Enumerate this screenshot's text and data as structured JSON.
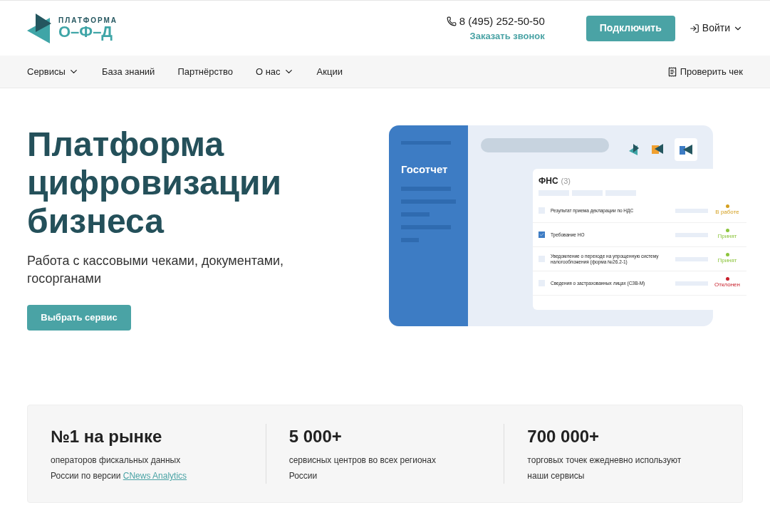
{
  "logo": {
    "line_1": "ПЛАТФОРМА",
    "line_2": "О–Ф–Д"
  },
  "header": {
    "phone": "8 (495) 252-50-50",
    "callback": "Заказать звонок",
    "connect": "Подключить",
    "login": "Войти"
  },
  "nav": {
    "items": [
      {
        "label": "Сервисы",
        "dropdown": true
      },
      {
        "label": "База знаний",
        "dropdown": false
      },
      {
        "label": "Партнёрство",
        "dropdown": false
      },
      {
        "label": "О нас",
        "dropdown": true
      },
      {
        "label": "Акции",
        "dropdown": false
      }
    ],
    "check": "Проверить чек"
  },
  "hero": {
    "title": "Платформа цифровизации бизнеса",
    "subtitle": "Работа с кассовыми чеками, документами, госорганами",
    "button": "Выбрать сервис"
  },
  "illustration": {
    "sidebar_title": "Госотчет",
    "panel_title": "ФНС",
    "panel_count": "(3)",
    "rows": [
      {
        "text": "Результат приема декларации по НДС",
        "checked": false,
        "status": "В работе",
        "color": "#d4a020"
      },
      {
        "text": "Требование НО",
        "checked": true,
        "status": "Принят",
        "color": "#8cc43c"
      },
      {
        "text": "Уведомление о переходе на упрощенную систему налогообложения (форма №26.2-1)",
        "checked": false,
        "status": "Принят",
        "color": "#8cc43c"
      },
      {
        "text": "Сведения о застрахованных лицах (СЗВ-М)",
        "checked": false,
        "status": "Отклонен",
        "color": "#c8202c"
      }
    ]
  },
  "stats": [
    {
      "value": "№1 на рынке",
      "text": "операторов фискальных данных России по версии",
      "link": "CNews Analytics"
    },
    {
      "value": "5 000+",
      "text": "сервисных центров во всех регионах России"
    },
    {
      "value": "700 000+",
      "text": "торговых точек ежедневно используют наши сервисы"
    }
  ]
}
